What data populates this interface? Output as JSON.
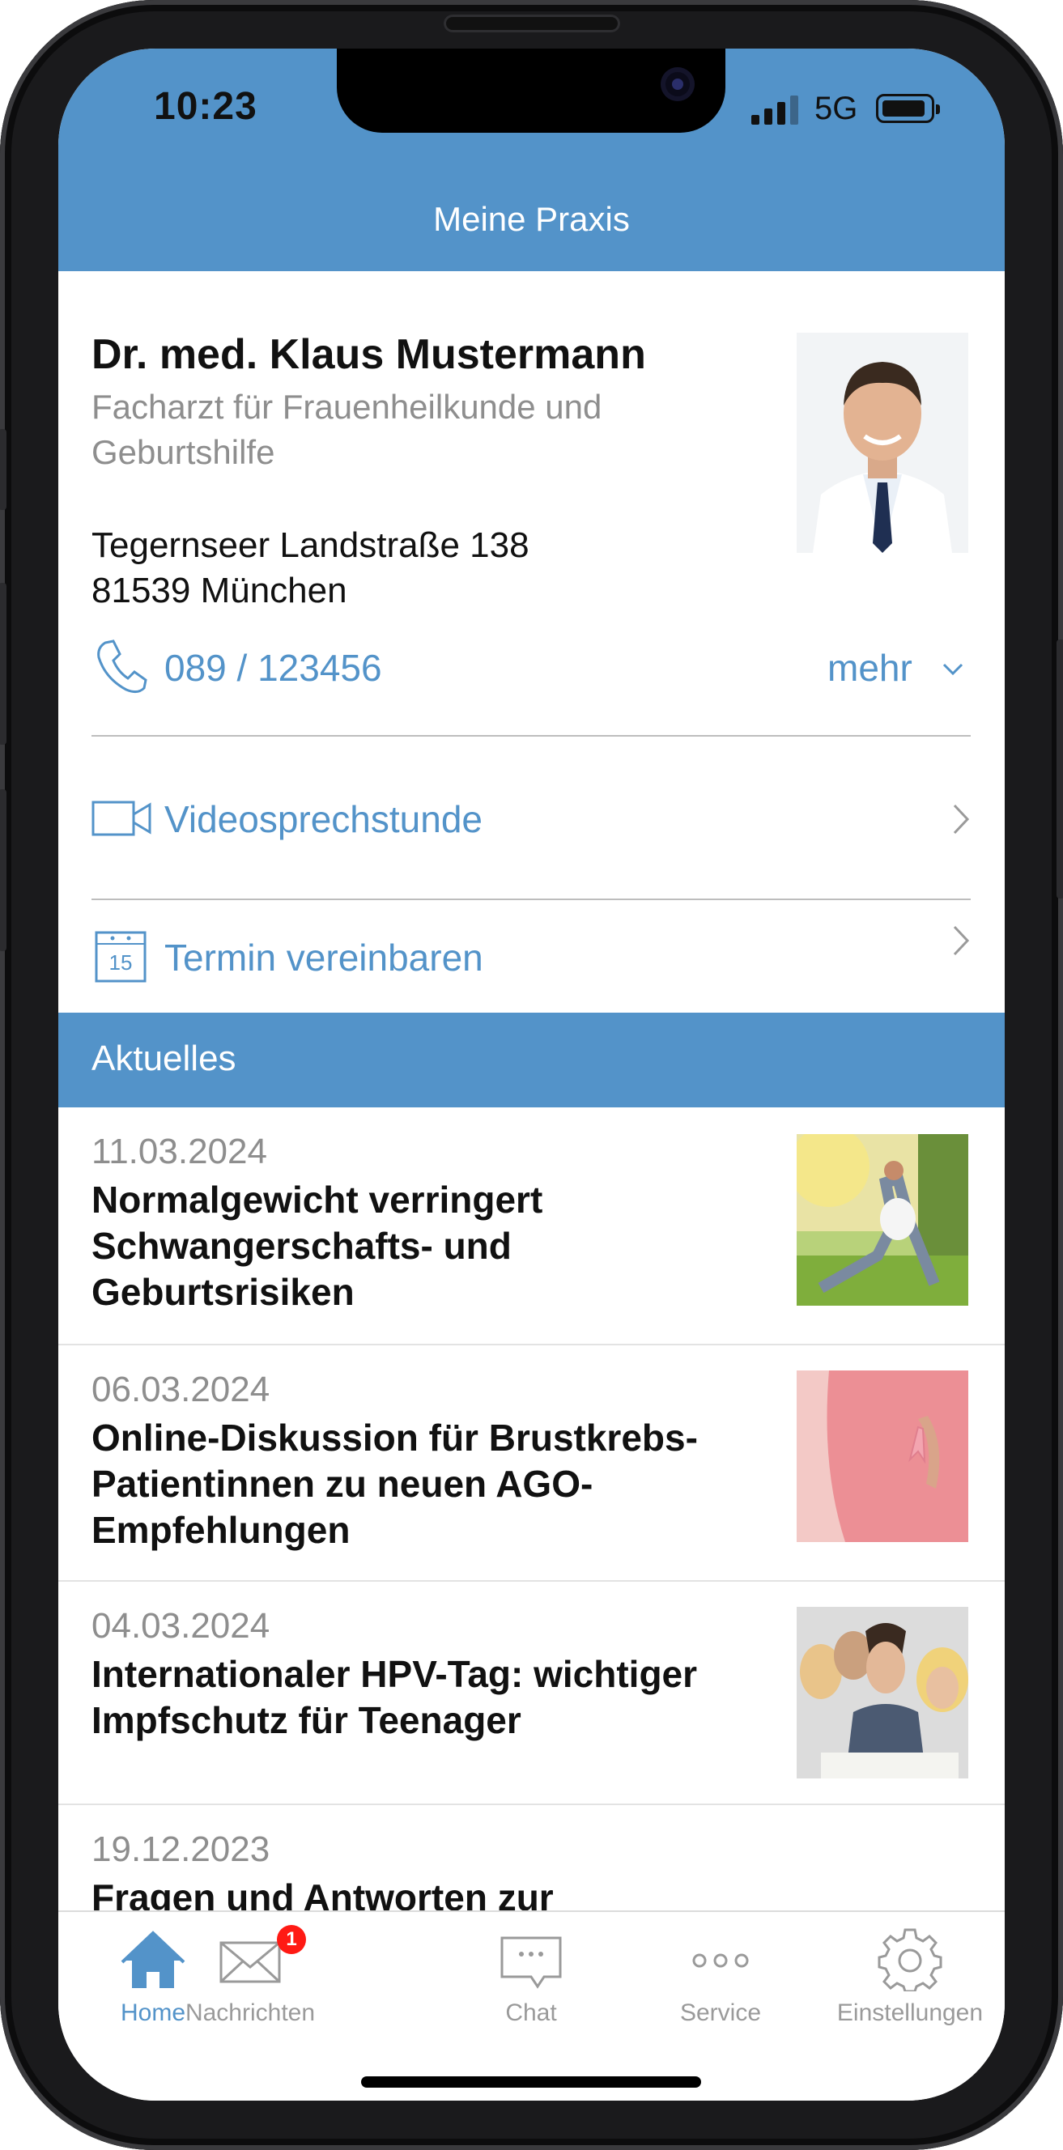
{
  "status_bar": {
    "time": "10:23",
    "network": "5G"
  },
  "header": {
    "title": "Meine Praxis"
  },
  "doctor": {
    "name": "Dr. med. Klaus Mustermann",
    "specialty": "Facharzt für Frauenheilkunde und Geburtshilfe",
    "address_line1": "Tegernseer Landstraße 138",
    "address_line2": "81539 München",
    "phone": "089 / 123456",
    "more_label": "mehr"
  },
  "actions": [
    {
      "label": "Videosprechstunde",
      "icon": "video-camera-icon"
    },
    {
      "label": "Termin vereinbaren",
      "icon": "calendar-icon",
      "calendar_day": "15"
    }
  ],
  "news_section": {
    "title": "Aktuelles",
    "items": [
      {
        "date": "11.03.2024",
        "title": "Normalgewicht verringert Schwangerschafts- und Geburtsrisiken",
        "thumb": "pregnant-woman-exercising-photo"
      },
      {
        "date": "06.03.2024",
        "title": "Online-Diskussion für Brustkrebs-Patientinnen zu neuen AGO-Empfehlungen",
        "thumb": "pink-ribbon-photo"
      },
      {
        "date": "04.03.2024",
        "title": "Internationaler HPV-Tag: wichtiger Impfschutz für Teenager",
        "thumb": "teenagers-photo"
      },
      {
        "date": "19.12.2023",
        "title": "Fragen und Antworten zur"
      }
    ]
  },
  "tabbar": {
    "tabs": [
      {
        "label": "Home",
        "icon": "home-icon",
        "active": true
      },
      {
        "label": "Nachrichten",
        "icon": "envelope-icon",
        "badge": "1"
      },
      {
        "label": "Chat",
        "icon": "chat-bubble-icon"
      },
      {
        "label": "Service",
        "icon": "three-dots-icon"
      },
      {
        "label": "Einstellungen",
        "icon": "gear-icon"
      }
    ]
  },
  "colors": {
    "accent": "#5393c9",
    "badge": "#ff1a14",
    "muted_text": "#8e8e8e"
  }
}
